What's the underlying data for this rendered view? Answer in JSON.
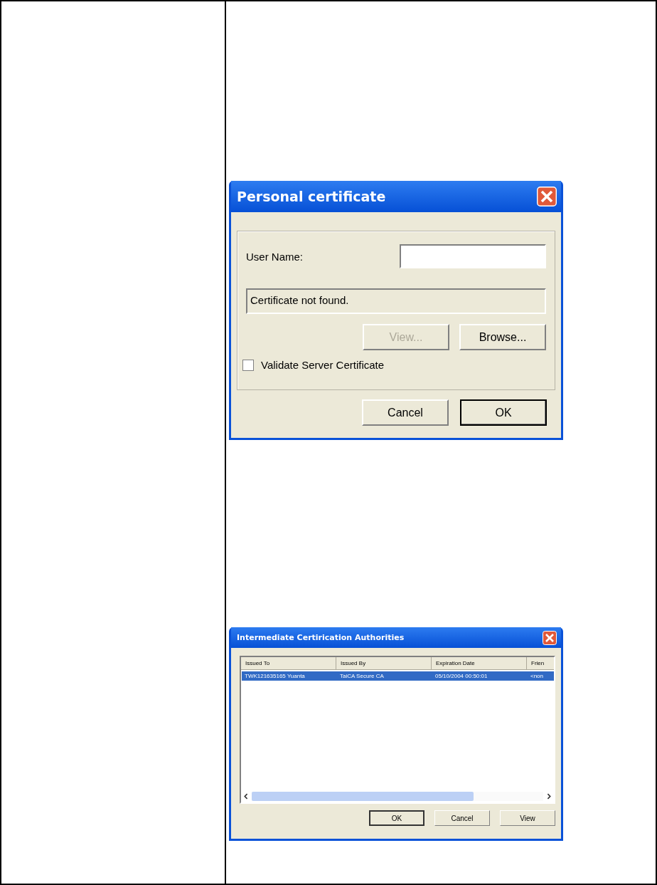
{
  "personal_dialog": {
    "title": "Personal certificate",
    "user_name_label": "User Name:",
    "status": "Certificate not found.",
    "buttons": [
      {
        "label": "View...",
        "disabled": true,
        "default": false
      },
      {
        "label": "Browse...",
        "disabled": false,
        "default": false
      }
    ],
    "checkbox": {
      "label": "Validate Server Certificate",
      "checked": false
    },
    "footer_buttons": [
      {
        "label": "Cancel",
        "default": false
      },
      {
        "label": "OK",
        "default": true
      }
    ]
  },
  "authorities_dialog": {
    "title": "Intermediate Certirication Authorities",
    "columns": [
      "Issued To",
      "Issued By",
      "Expiration Date",
      "Frien"
    ],
    "rows": [
      {
        "cells": [
          "TWK121635165 Yuanta",
          "TaiCA Secure CA",
          "05/10/2004 00:50:01",
          "<non"
        ],
        "selected": true
      }
    ],
    "footer_buttons": [
      {
        "label": "OK",
        "default": true
      },
      {
        "label": "Cancel",
        "default": false
      },
      {
        "label": "View",
        "default": false
      }
    ]
  }
}
